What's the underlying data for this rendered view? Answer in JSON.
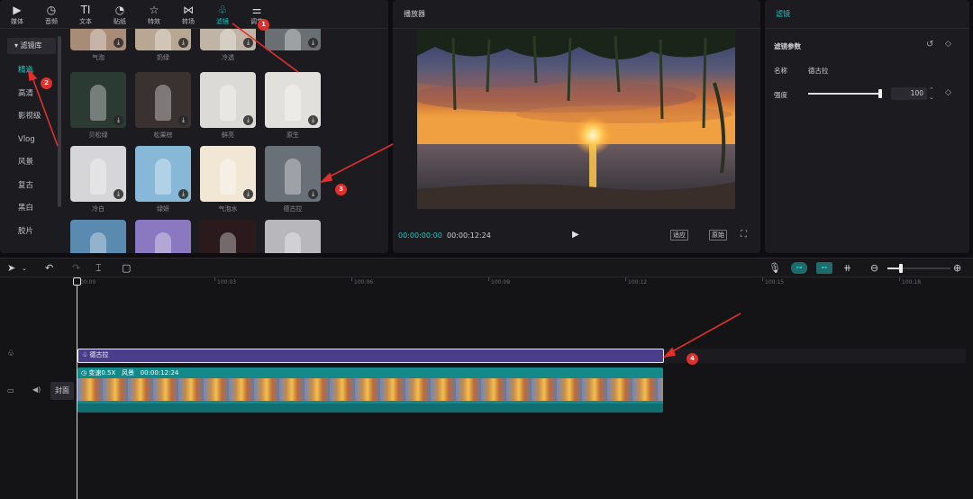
{
  "top_tabs": [
    {
      "label": "媒体",
      "icon": "media-icon",
      "glyph": "▶"
    },
    {
      "label": "音频",
      "icon": "audio-icon",
      "glyph": "◷"
    },
    {
      "label": "文本",
      "icon": "text-icon",
      "glyph": "TI"
    },
    {
      "label": "贴纸",
      "icon": "sticker-icon",
      "glyph": "◔"
    },
    {
      "label": "特效",
      "icon": "effects-icon",
      "glyph": "☆"
    },
    {
      "label": "转场",
      "icon": "transition-icon",
      "glyph": "⋈"
    },
    {
      "label": "滤镜",
      "icon": "filter-icon",
      "glyph": "♧"
    },
    {
      "label": "调节",
      "icon": "adjust-icon",
      "glyph": "⚌"
    }
  ],
  "sidebar": {
    "header": "▾ 滤镜库",
    "items": [
      "精选",
      "高清",
      "影视级",
      "Vlog",
      "风景",
      "复古",
      "黑白",
      "胶片"
    ]
  },
  "filters": [
    {
      "label": "气泡",
      "bg": "#a88c78"
    },
    {
      "label": "奶绿",
      "bg": "#b8a792"
    },
    {
      "label": "冷透",
      "bg": "#bfb4a6"
    },
    {
      "label": "",
      "bg": "#6a6f74"
    },
    {
      "label": "贝松绿",
      "bg": "#2c3a34"
    },
    {
      "label": "松果棕",
      "bg": "#3a3230"
    },
    {
      "label": "鲜亮",
      "bg": "#dcdad6"
    },
    {
      "label": "原生",
      "bg": "#e2e0dc"
    },
    {
      "label": "冷白",
      "bg": "#d6d6d8"
    },
    {
      "label": "绿妍",
      "bg": "#88b8d8"
    },
    {
      "label": "气泡水",
      "bg": "#f2e6d4"
    },
    {
      "label": "德古拉",
      "bg": "#6a7078"
    },
    {
      "label": "",
      "bg": "#5a8ab0"
    },
    {
      "label": "",
      "bg": "#8a78c0"
    },
    {
      "label": "",
      "bg": "#2a1a1c"
    },
    {
      "label": "",
      "bg": "#b8b8bc"
    }
  ],
  "player": {
    "title": "播放器",
    "current_time": "00:00:00:00",
    "total_time": "00:00:12:24",
    "btn_original": "原始",
    "btn_ratio": "适应",
    "play_icon": "play-icon",
    "fullscreen_icon": "fullscreen-icon"
  },
  "props": {
    "tab": "滤镜",
    "section": "滤镜参数",
    "name_label": "名称",
    "name_value": "德古拉",
    "strength_label": "强度",
    "strength_value": "100",
    "strength_fraction": 1.0
  },
  "timeline": {
    "ticks": [
      "00:00",
      "100:03",
      "100:06",
      "100:09",
      "100:12",
      "100:15",
      "100:18"
    ],
    "filter_clip_label": "德古拉",
    "video_clip_speed": "变速0.5X",
    "video_clip_name": "风景",
    "video_clip_duration": "00:00:12:24",
    "cover_label": "封面"
  },
  "annotations": [
    "1",
    "2",
    "3",
    "4"
  ],
  "colors": {
    "accent": "#22c5c5",
    "filter_clip": "#4a3e8c",
    "video_clip": "#14898a",
    "annotation": "#e0302c"
  }
}
